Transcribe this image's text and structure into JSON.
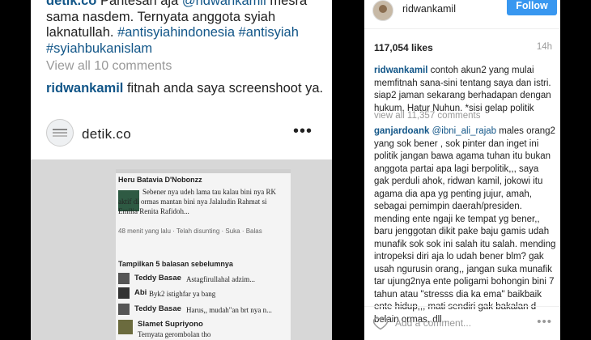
{
  "left_post": {
    "caption_user": "detik.co",
    "caption_lead": "Pantesan aja",
    "caption_mention": "@ridwankamil",
    "caption_tail": "mesra sama nasdem. Ternyata anggota syiah laknatullah.",
    "caption_tags": "#antisyiahindonesia #antisyiah #syiahbukanislam",
    "view_all": "View all 10 comments",
    "comment_user": "ridwankamil",
    "comment_text": "fitnah anda saya screenshoot ya.",
    "account_name": "detik.co",
    "more_icon": "•••"
  },
  "fb_screenshot": {
    "top_name": "Heru Batavia D'Nobonzz",
    "post_text": "Sebener nya udeh lama tau kalau bini nya RK aktif di ormas mantan bini nya Jalaludin Rahmat si Emilia Renita Rafidoh...",
    "post_meta": "48 menit yang lalu · Telah disunting · Suka · Balas",
    "replies_label": "Tampilkan 5 balasan sebelumnya",
    "replies": [
      {
        "name": "Teddy Basae",
        "text": "Astagfirullahal adzim..."
      },
      {
        "name": "Abi",
        "text": "Byk2 istighfar ya bang"
      },
      {
        "name": "Teddy Basae",
        "text": "Harus,, mudah\"an brt nya n..."
      }
    ],
    "bottom_name": "Slamet Supriyono",
    "bottom_text": "Ternyata gerombolan tho"
  },
  "right_panel": {
    "username": "ridwankamil",
    "follow_label": "Follow",
    "likes": "117,054 likes",
    "time": "14h",
    "caption_user": "ridwankamil",
    "caption_text": "contoh akun2 yang mulai memfitnah sana-sini tentang saya dan istri. siap2 jaman sekarang berhadapan dengan hukum. Hatur Nuhun. *sisi gelap politik",
    "view_all": "view all 11,357 comments",
    "comment_user": "ganjardoank",
    "comment_mention": "@ibni_ali_rajab",
    "comment_text": "males orang2 yang sok bener , sok pinter dan inget ini politik jangan bawa agama tuhan itu bukan anggota partai apa lagi berpolitik,,, saya gak perduli ahok, ridwan kamil, jokowi itu agama dia apa yg penting jujur, amah, sebagai pemimpin daerah/presiden. mending ente ngaji ke tempat yg bener,, baru jenggotan dikit pake baju gamis udah munafik sok sok ini salah itu salah. mending intropeksi diri aja lo udah bener blm? gak usah ngurusin orang,, jangan suka munafik tar ujung2nya ente poligami bohongin bini 7 tahun atau \"stresss dia ka ema\" baikbaik ente hidup,,, mati sendiri gak bakalan d belain ormas, dll ,,",
    "add_comment_placeholder": "Add a comment...",
    "more_icon": "•••"
  },
  "colors": {
    "link": "#125688",
    "follow": "#3897f0",
    "background": "#000000"
  }
}
